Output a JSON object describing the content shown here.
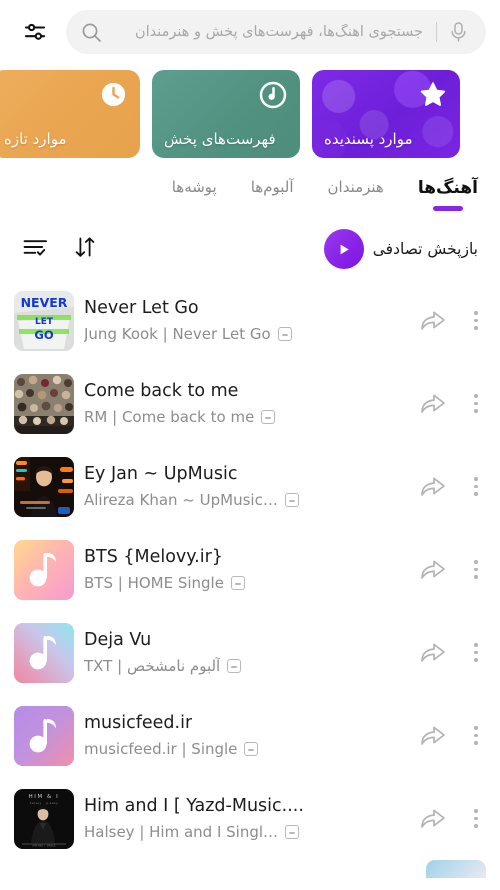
{
  "search": {
    "placeholder": "جستجوی آهنگ‌ها، فهرست‌های پخش و هنرمندان",
    "search_icon": "search-icon",
    "mic_icon": "microphone-icon",
    "filter_icon": "sliders-settings-icon"
  },
  "categories": [
    {
      "label": "موارد پسندیده",
      "icon": "star-icon",
      "color": "#7722e0",
      "theme": "purple"
    },
    {
      "label": "فهرست‌های پخش",
      "icon": "playlist-disc-icon",
      "color": "#51917f",
      "theme": "teal"
    },
    {
      "label": "موارد تازه",
      "icon": "clock-icon",
      "color": "#e9a550",
      "theme": "orange"
    }
  ],
  "tabs": [
    {
      "label": "آهنگ‌ها",
      "active": true
    },
    {
      "label": "هنرمندان",
      "active": false
    },
    {
      "label": "آلبوم‌ها",
      "active": false
    },
    {
      "label": "پوشه‌ها",
      "active": false
    }
  ],
  "tab_accent": "#8627e8",
  "shuffle": {
    "label": "بازپخش تصادفی",
    "play_icon": "play-icon",
    "sort_icon": "sort-arrows-icon",
    "list_icon": "list-check-icon"
  },
  "songs": [
    {
      "title": "Never Let Go",
      "subtitle": "Jung Kook | Never Let Go",
      "art": "never-let-go",
      "kebab_icon": "more-vertical-icon",
      "share_icon": "share-arrow-icon"
    },
    {
      "title": "Come back to me",
      "subtitle": "RM | Come back to me",
      "art": "crowd-photo",
      "kebab_icon": "more-vertical-icon",
      "share_icon": "share-arrow-icon"
    },
    {
      "title": "Ey Jan ~ UpMusic",
      "subtitle": "Alireza Khan ~ UpMusic…",
      "art": "neon-portrait",
      "kebab_icon": "more-vertical-icon",
      "share_icon": "share-arrow-icon"
    },
    {
      "title": "BTS {Melovy.ir}",
      "subtitle": "BTS | HOME Single",
      "art": "note-yellow-pink",
      "kebab_icon": "more-vertical-icon",
      "share_icon": "share-arrow-icon"
    },
    {
      "title": "Deja Vu",
      "subtitle": "TXT | آلبوم نامشخص",
      "art": "note-cyan-pink",
      "kebab_icon": "more-vertical-icon",
      "share_icon": "share-arrow-icon"
    },
    {
      "title": "musicfeed.ir",
      "subtitle": "musicfeed.ir | Single",
      "art": "note-purple-pink",
      "kebab_icon": "more-vertical-icon",
      "share_icon": "share-arrow-icon"
    },
    {
      "title": "Him and I [ Yazd-Music....",
      "subtitle": "Halsey | Him and I Singl…",
      "art": "him-and-i-dark",
      "kebab_icon": "more-vertical-icon",
      "share_icon": "share-arrow-icon"
    }
  ]
}
